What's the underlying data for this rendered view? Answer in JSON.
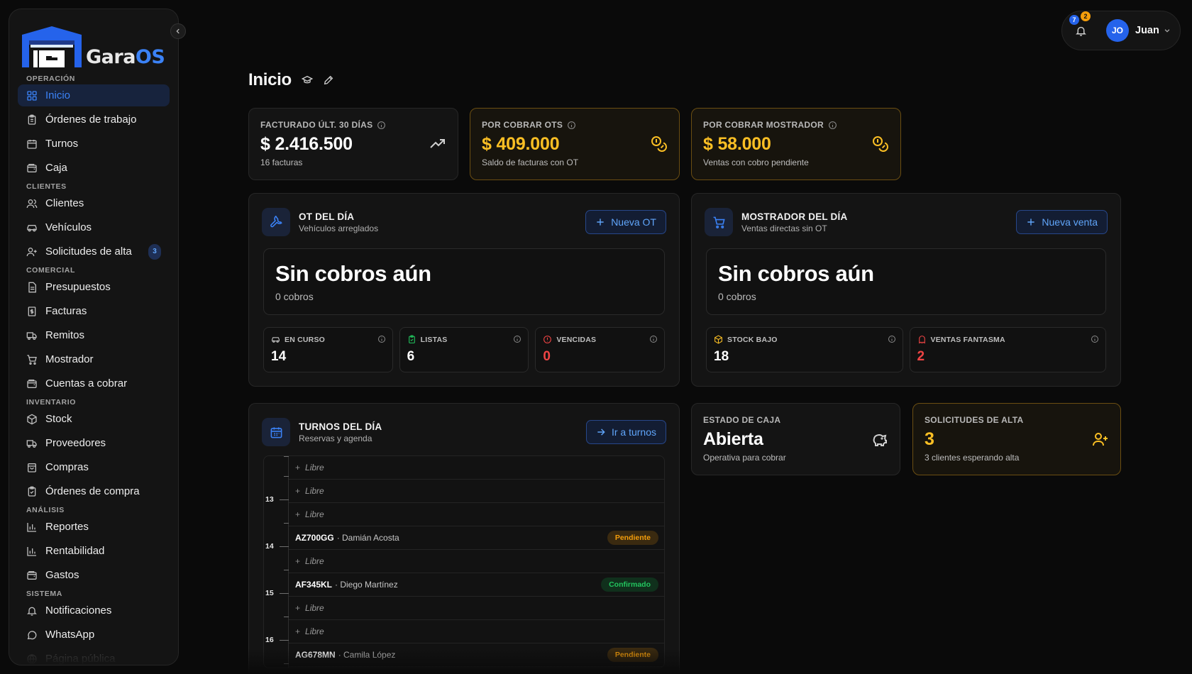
{
  "app": {
    "logo_word_1": "Gara",
    "logo_word_2": "OS"
  },
  "sidebar": {
    "sections": [
      {
        "label": "OPERACIÓN"
      },
      {
        "label": "CLIENTES"
      },
      {
        "label": "COMERCIAL"
      },
      {
        "label": "INVENTARIO"
      },
      {
        "label": "ANÁLISIS"
      },
      {
        "label": "SISTEMA"
      }
    ],
    "items": [
      {
        "label": "Inicio",
        "icon": "grid-icon"
      },
      {
        "label": "Órdenes de trabajo",
        "icon": "clipboard-icon"
      },
      {
        "label": "Turnos",
        "icon": "calendar-icon"
      },
      {
        "label": "Caja",
        "icon": "wallet-icon"
      },
      {
        "label": "Clientes",
        "icon": "users-icon"
      },
      {
        "label": "Vehículos",
        "icon": "car-icon"
      },
      {
        "label": "Solicitudes de alta",
        "icon": "user-plus-icon",
        "badge": "3"
      },
      {
        "label": "Presupuestos",
        "icon": "file-icon"
      },
      {
        "label": "Facturas",
        "icon": "receipt-icon"
      },
      {
        "label": "Remitos",
        "icon": "truck-icon"
      },
      {
        "label": "Mostrador",
        "icon": "cart-icon"
      },
      {
        "label": "Cuentas a cobrar",
        "icon": "wallet-icon"
      },
      {
        "label": "Stock",
        "icon": "box-icon"
      },
      {
        "label": "Proveedores",
        "icon": "truck-icon"
      },
      {
        "label": "Compras",
        "icon": "bag-icon"
      },
      {
        "label": "Órdenes de compra",
        "icon": "clipboard-icon"
      },
      {
        "label": "Reportes",
        "icon": "bar-chart-icon"
      },
      {
        "label": "Rentabilidad",
        "icon": "bar-chart-icon"
      },
      {
        "label": "Gastos",
        "icon": "wallet-icon"
      },
      {
        "label": "Notificaciones",
        "icon": "bell-icon"
      },
      {
        "label": "WhatsApp",
        "icon": "chat-icon"
      },
      {
        "label": "Página pública",
        "icon": "globe-icon"
      }
    ]
  },
  "header": {
    "notif_blue": "7",
    "notif_amber": "2",
    "user_initials": "JO",
    "user_name": "Juan"
  },
  "page": {
    "title": "Inicio"
  },
  "kpis": [
    {
      "label": "FACTURADO ÚLT. 30 DÍAS",
      "value": "$ 2.416.500",
      "sub": "16 facturas",
      "icon": "trending-up-icon"
    },
    {
      "label": "POR COBRAR OTS",
      "value": "$ 409.000",
      "sub": "Saldo de facturas con OT",
      "icon": "coins-icon"
    },
    {
      "label": "POR COBRAR MOSTRADOR",
      "value": "$ 58.000",
      "sub": "Ventas con cobro pendiente",
      "icon": "coins-icon"
    }
  ],
  "ot_panel": {
    "title": "OT DEL DÍA",
    "subtitle": "Vehículos arreglados",
    "button": "Nueva OT",
    "empty_title": "Sin cobros aún",
    "empty_sub": "0 cobros",
    "stats": [
      {
        "label": "EN CURSO",
        "value": "14",
        "icon": "car-icon"
      },
      {
        "label": "LISTAS",
        "value": "6",
        "icon": "clipboard-check-icon"
      },
      {
        "label": "VENCIDAS",
        "value": "0",
        "icon": "alert-icon"
      }
    ]
  },
  "mostrador_panel": {
    "title": "MOSTRADOR DEL DÍA",
    "subtitle": "Ventas directas sin OT",
    "button": "Nueva venta",
    "empty_title": "Sin cobros aún",
    "empty_sub": "0 cobros",
    "stats": [
      {
        "label": "STOCK BAJO",
        "value": "18",
        "icon": "box-icon"
      },
      {
        "label": "VENTAS FANTASMA",
        "value": "2",
        "icon": "ghost-icon"
      }
    ]
  },
  "turnos_panel": {
    "title": "TURNOS DEL DÍA",
    "subtitle": "Reservas y agenda",
    "button": "Ir a turnos",
    "free_label": "Libre",
    "hours": [
      "13",
      "14",
      "15",
      "16"
    ],
    "slots": [
      {
        "free": true
      },
      {
        "free": true
      },
      {
        "free": true
      },
      {
        "plate": "AZ700GG",
        "name": "· Damián Acosta",
        "status": "Pendiente"
      },
      {
        "free": true
      },
      {
        "plate": "AF345KL",
        "name": "· Diego Martínez",
        "status": "Confirmado"
      },
      {
        "free": true
      },
      {
        "free": true
      },
      {
        "plate": "AG678MN",
        "name": "· Camila López",
        "status": "Pendiente"
      }
    ]
  },
  "caja": {
    "label": "ESTADO DE CAJA",
    "value": "Abierta",
    "sub": "Operativa para cobrar",
    "icon": "piggy-bank-icon"
  },
  "solicitudes": {
    "label": "SOLICITUDES DE ALTA",
    "value": "3",
    "sub": "3 clientes esperando alta",
    "icon": "user-plus-icon"
  },
  "colors": {
    "accent": "#3b82f6",
    "gold": "#fbbf24",
    "danger": "#ef4444",
    "success": "#22c55e"
  }
}
